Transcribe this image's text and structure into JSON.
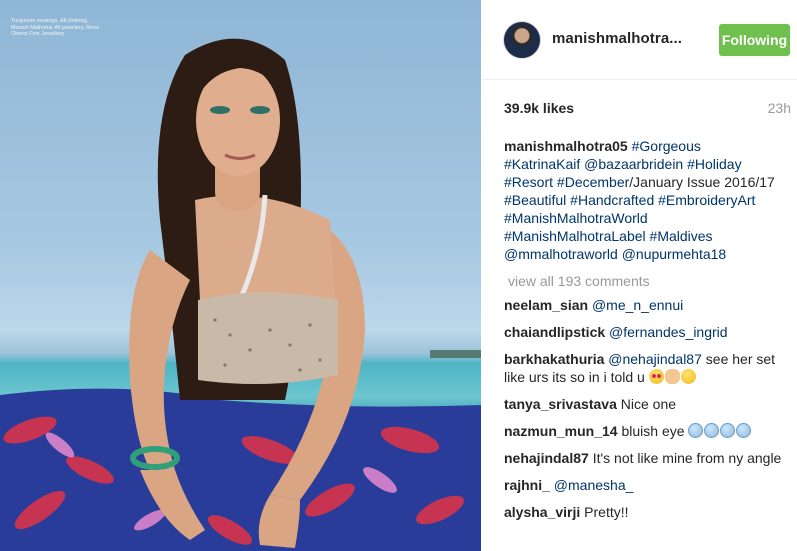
{
  "photo": {
    "credit": "Turquoise musings, All clothing, Manish Malhotra; All jewellery, Renu Oberoi Fine Jewellery"
  },
  "post": {
    "username": "manishmalhotra...",
    "follow_label": "Following",
    "likes": "39.9k likes",
    "time": "23h",
    "caption_user": "manishmalhotra05",
    "caption_parts": [
      {
        "text": "#Gorgeous",
        "tag": true
      },
      {
        "text": "#KatrinaKaif",
        "tag": true
      },
      {
        "text": "@bazaarbridein",
        "tag": true
      },
      {
        "text": "#Holiday",
        "tag": true
      },
      {
        "text": "#Resort",
        "tag": true
      },
      {
        "text": "#December",
        "tag": true
      },
      {
        "text": "/January Issue 2016/17",
        "tag": false
      },
      {
        "text": "#Beautiful",
        "tag": true
      },
      {
        "text": "#Handcrafted",
        "tag": true
      },
      {
        "text": "#EmbroideryArt",
        "tag": true
      },
      {
        "text": "#ManishMalhotraWorld",
        "tag": true
      },
      {
        "text": "#ManishMalhotraLabel",
        "tag": true
      },
      {
        "text": "#Maldives",
        "tag": true
      },
      {
        "text": "@mmalhotraworld",
        "tag": true
      },
      {
        "text": "@nupurmehta18",
        "tag": true
      }
    ],
    "view_all": "view all 193 comments"
  },
  "comments": [
    {
      "user": "neelam_sian",
      "mention": "@me_n_ennui",
      "text": "",
      "emojis": []
    },
    {
      "user": "chaiandlipstick",
      "mention": "@fernandes_ingrid",
      "text": "",
      "emojis": []
    },
    {
      "user": "barkhakathuria",
      "mention": "@nehajindal87",
      "text": "see her set like urs its so in i told u",
      "emojis": [
        "heart-eyes-emoji",
        "ok-hand-emoji",
        "smiling-emoji"
      ]
    },
    {
      "user": "tanya_srivastava",
      "mention": "",
      "text": "Nice one",
      "emojis": []
    },
    {
      "user": "nazmun_mun_14",
      "mention": "",
      "text": "bluish eye",
      "emojis": [
        "cold-face-emoji",
        "cold-face-emoji",
        "cold-face-emoji",
        "cold-face-emoji"
      ]
    },
    {
      "user": "nehajindal87",
      "mention": "",
      "text": "It's not like mine from ny angle",
      "emojis": []
    },
    {
      "user": "rajhni_",
      "mention": "@manesha_",
      "text": "",
      "emojis": []
    },
    {
      "user": "alysha_virji",
      "mention": "",
      "text": "Pretty!!",
      "emojis": []
    }
  ],
  "colors": {
    "follow_bg": "#70c050",
    "tag": "#003569",
    "muted": "#999999"
  }
}
